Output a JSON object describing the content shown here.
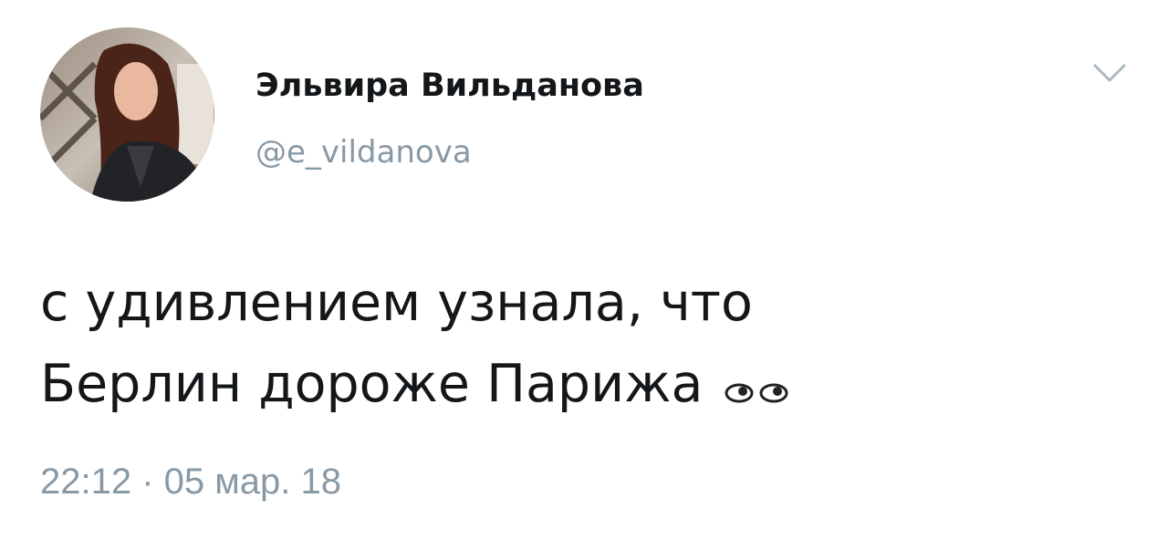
{
  "tweet": {
    "author": {
      "display_name": "Эльвира Вильданова",
      "handle": "@e_vildanova",
      "avatar": "user-photo-avatar"
    },
    "menu_icon": "chevron-down-icon",
    "text_lines": [
      "с удивлением узнала, что",
      "Берлин дороже Парижа"
    ],
    "emoji": "eyes-emoji",
    "timestamp": "22:12 · 05 мар. 18"
  },
  "colors": {
    "text_primary": "#14171a",
    "text_secondary": "#8899a6",
    "background": "#ffffff"
  }
}
